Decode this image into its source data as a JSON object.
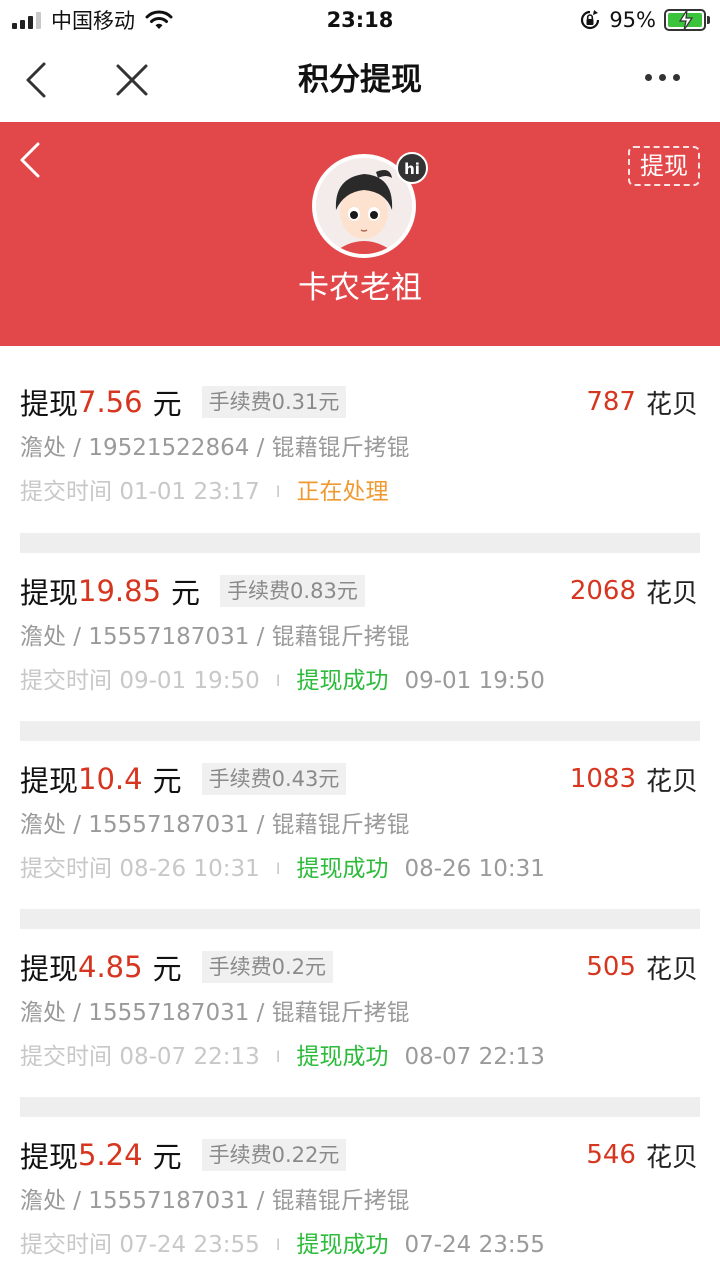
{
  "status_bar": {
    "carrier": "中国移动",
    "time": "23:18",
    "battery": "95%"
  },
  "nav": {
    "title": "积分提现",
    "back_icon": "chevron-left-icon",
    "close_icon": "close-icon",
    "more_icon": "more-dots-icon"
  },
  "banner": {
    "bg_color": "#e2474a",
    "withdraw_label": "提现",
    "hi_badge": "hi",
    "username": "卡农老祖"
  },
  "labels": {
    "withdraw_prefix": "提现",
    "currency_unit": "元",
    "points_unit": "花贝",
    "submit_prefix": "提交时间"
  },
  "records": [
    {
      "amount": "7.56",
      "fee": "手续费0.31元",
      "points": "787",
      "account": "澹处 / 19521522864 / 锟藉锟斤拷锟",
      "submit_time": "01-01 23:17",
      "status": "正在处理",
      "status_type": "processing",
      "done_time": ""
    },
    {
      "amount": "19.85",
      "fee": "手续费0.83元",
      "points": "2068",
      "account": "澹处 / 15557187031 / 锟藉锟斤拷锟",
      "submit_time": "09-01 19:50",
      "status": "提现成功",
      "status_type": "success",
      "done_time": "09-01 19:50"
    },
    {
      "amount": "10.4",
      "fee": "手续费0.43元",
      "points": "1083",
      "account": "澹处 / 15557187031 / 锟藉锟斤拷锟",
      "submit_time": "08-26 10:31",
      "status": "提现成功",
      "status_type": "success",
      "done_time": "08-26 10:31"
    },
    {
      "amount": "4.85",
      "fee": "手续费0.2元",
      "points": "505",
      "account": "澹处 / 15557187031 / 锟藉锟斤拷锟",
      "submit_time": "08-07 22:13",
      "status": "提现成功",
      "status_type": "success",
      "done_time": "08-07 22:13"
    },
    {
      "amount": "5.24",
      "fee": "手续费0.22元",
      "points": "546",
      "account": "澹处 / 15557187031 / 锟藉锟斤拷锟",
      "submit_time": "07-24 23:55",
      "status": "提现成功",
      "status_type": "success",
      "done_time": "07-24 23:55"
    }
  ],
  "colors": {
    "amount": "#d6351f",
    "processing": "#f09a32",
    "success": "#2cbb3a"
  }
}
